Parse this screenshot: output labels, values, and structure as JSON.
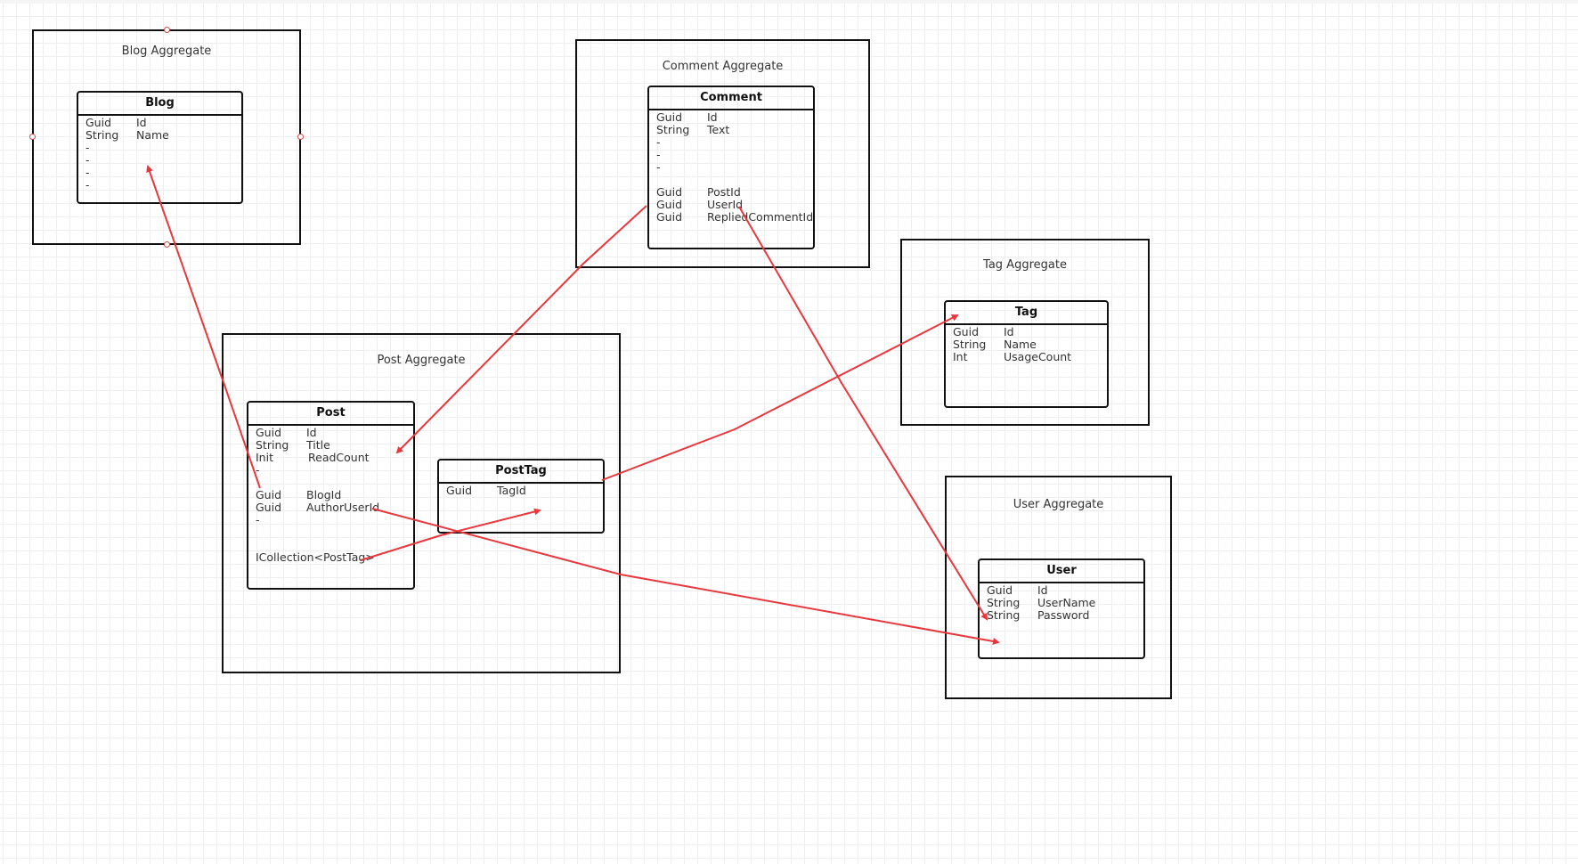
{
  "diagram": {
    "aggregates": {
      "blog": {
        "title": "Blog Aggregate"
      },
      "comment": {
        "title": "Comment Aggregate"
      },
      "tag": {
        "title": "Tag Aggregate"
      },
      "post": {
        "title": "Post Aggregate"
      },
      "user": {
        "title": "User Aggregate"
      }
    },
    "entities": {
      "blog": {
        "name": "Blog",
        "rows": [
          {
            "type": "Guid",
            "name": "Id"
          },
          {
            "type": "String",
            "name": "Name"
          },
          {
            "type": "-",
            "name": ""
          },
          {
            "type": "-",
            "name": ""
          },
          {
            "type": "-",
            "name": ""
          },
          {
            "type": "-",
            "name": ""
          }
        ]
      },
      "comment": {
        "name": "Comment",
        "rows": [
          {
            "type": "Guid",
            "name": "Id"
          },
          {
            "type": "String",
            "name": "Text"
          },
          {
            "type": "-",
            "name": ""
          },
          {
            "type": "-",
            "name": ""
          },
          {
            "type": "-",
            "name": ""
          },
          {
            "type": "",
            "name": ""
          },
          {
            "type": "Guid",
            "name": "PostId"
          },
          {
            "type": "Guid",
            "name": "UserId"
          },
          {
            "type": "Guid",
            "name": "RepliedCommentId"
          }
        ]
      },
      "tag": {
        "name": "Tag",
        "rows": [
          {
            "type": "Guid",
            "name": "Id"
          },
          {
            "type": "String",
            "name": "Name"
          },
          {
            "type": "Int",
            "name": "UsageCount"
          }
        ]
      },
      "post": {
        "name": "Post",
        "rows": [
          {
            "type": "Guid",
            "name": "Id"
          },
          {
            "type": "String",
            "name": "Title"
          },
          {
            "type": "Init",
            "name": "ReadCount"
          },
          {
            "type": "-",
            "name": ""
          },
          {
            "type": "",
            "name": ""
          },
          {
            "type": "Guid",
            "name": "BlogId"
          },
          {
            "type": "Guid",
            "name": "AuthorUserId"
          },
          {
            "type": "-",
            "name": ""
          },
          {
            "type": "",
            "name": ""
          },
          {
            "type": "",
            "name": ""
          },
          {
            "type": "ICollection<PostTag>",
            "name": ""
          }
        ]
      },
      "posttag": {
        "name": "PostTag",
        "rows": [
          {
            "type": "Guid",
            "name": "TagId"
          }
        ]
      },
      "user": {
        "name": "User",
        "rows": [
          {
            "type": "Guid",
            "name": "Id"
          },
          {
            "type": "String",
            "name": "UserName"
          },
          {
            "type": "String",
            "name": "Password"
          }
        ]
      }
    },
    "colors": {
      "relation": "#e8383d",
      "border": "#111111",
      "grid": "#eeeeee",
      "handle": "#c74a4a"
    }
  }
}
